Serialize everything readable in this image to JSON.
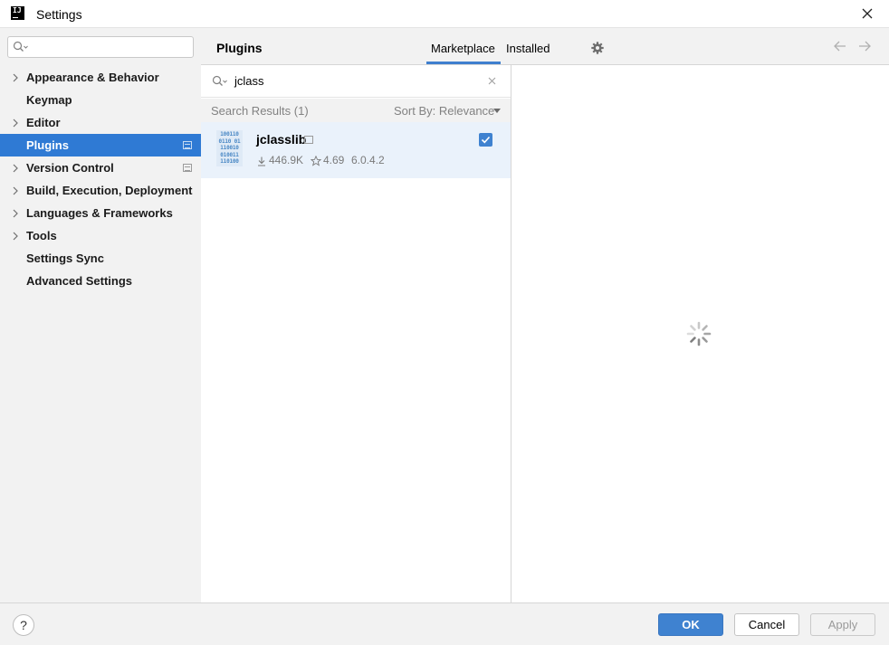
{
  "window": {
    "title": "Settings"
  },
  "sidebar": {
    "search_placeholder": "",
    "items": [
      {
        "label": "Appearance & Behavior",
        "expandable": true
      },
      {
        "label": "Keymap",
        "expandable": false
      },
      {
        "label": "Editor",
        "expandable": true
      },
      {
        "label": "Plugins",
        "expandable": false,
        "selected": true
      },
      {
        "label": "Version Control",
        "expandable": true
      },
      {
        "label": "Build, Execution, Deployment",
        "expandable": true
      },
      {
        "label": "Languages & Frameworks",
        "expandable": true
      },
      {
        "label": "Tools",
        "expandable": true
      },
      {
        "label": "Settings Sync",
        "expandable": false
      },
      {
        "label": "Advanced Settings",
        "expandable": false
      }
    ]
  },
  "header": {
    "title": "Plugins",
    "tabs": [
      {
        "label": "Marketplace",
        "active": true
      },
      {
        "label": "Installed",
        "active": false
      }
    ]
  },
  "search": {
    "query": "jclass"
  },
  "results": {
    "count_label": "Search Results (1)",
    "sort_label": "Sort By: Relevance"
  },
  "plugin": {
    "name": "jclasslib",
    "logo_text": "100110\n0110 01\n110010\n010011\n110100",
    "downloads": "446.9K",
    "rating": "4.69",
    "version": "6.0.4.2",
    "enabled": true
  },
  "footer": {
    "help": "?",
    "ok": "OK",
    "cancel": "Cancel",
    "apply": "Apply"
  },
  "colors": {
    "accent": "#2f7ad4",
    "selected_row": "#eaf2fb"
  }
}
